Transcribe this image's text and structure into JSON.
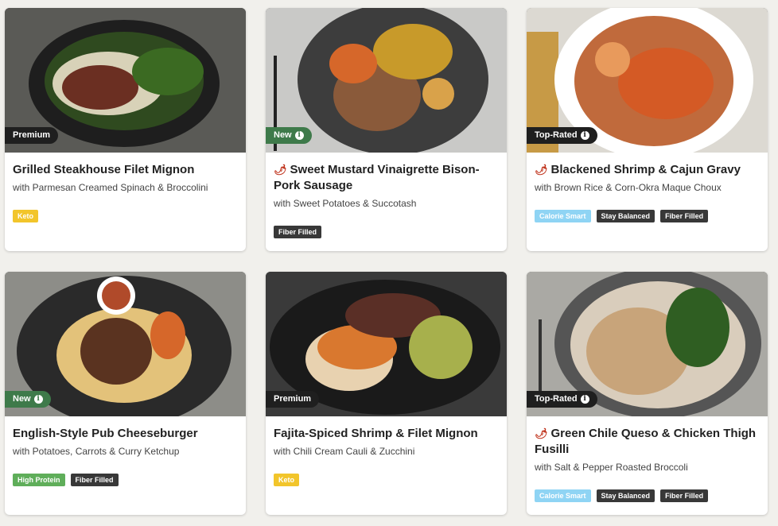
{
  "cards": [
    {
      "tag": "Premium",
      "title": "Grilled Steakhouse Filet Mignon",
      "subtitle": "with Parmesan Creamed Spinach & Broccolini",
      "badges": [
        "Keto"
      ]
    },
    {
      "tag": "New",
      "title": "Sweet Mustard Vinaigrette Bison-Pork Sausage",
      "subtitle": "with Sweet Potatoes & Succotash",
      "badges": [
        "Fiber Filled"
      ]
    },
    {
      "tag": "Top-Rated",
      "title": "Blackened Shrimp & Cajun Gravy",
      "subtitle": "with Brown Rice & Corn-Okra Maque Choux",
      "badges": [
        "Calorie Smart",
        "Stay Balanced",
        "Fiber Filled"
      ]
    },
    {
      "tag": "New",
      "title": "English-Style Pub Cheeseburger",
      "subtitle": "with Potatoes, Carrots & Curry Ketchup",
      "badges": [
        "High Protein",
        "Fiber Filled"
      ]
    },
    {
      "tag": "Premium",
      "title": "Fajita-Spiced Shrimp & Filet Mignon",
      "subtitle": "with Chili Cream Cauli & Zucchini",
      "badges": [
        "Keto"
      ]
    },
    {
      "tag": "Top-Rated",
      "title": "Green Chile Queso & Chicken Thigh Fusilli",
      "subtitle": "with Salt & Pepper Roasted Broccoli",
      "badges": [
        "Calorie Smart",
        "Stay Balanced",
        "Fiber Filled"
      ]
    }
  ],
  "icons": {
    "spicy": "chili-pepper-icon",
    "info": "info-icon"
  }
}
